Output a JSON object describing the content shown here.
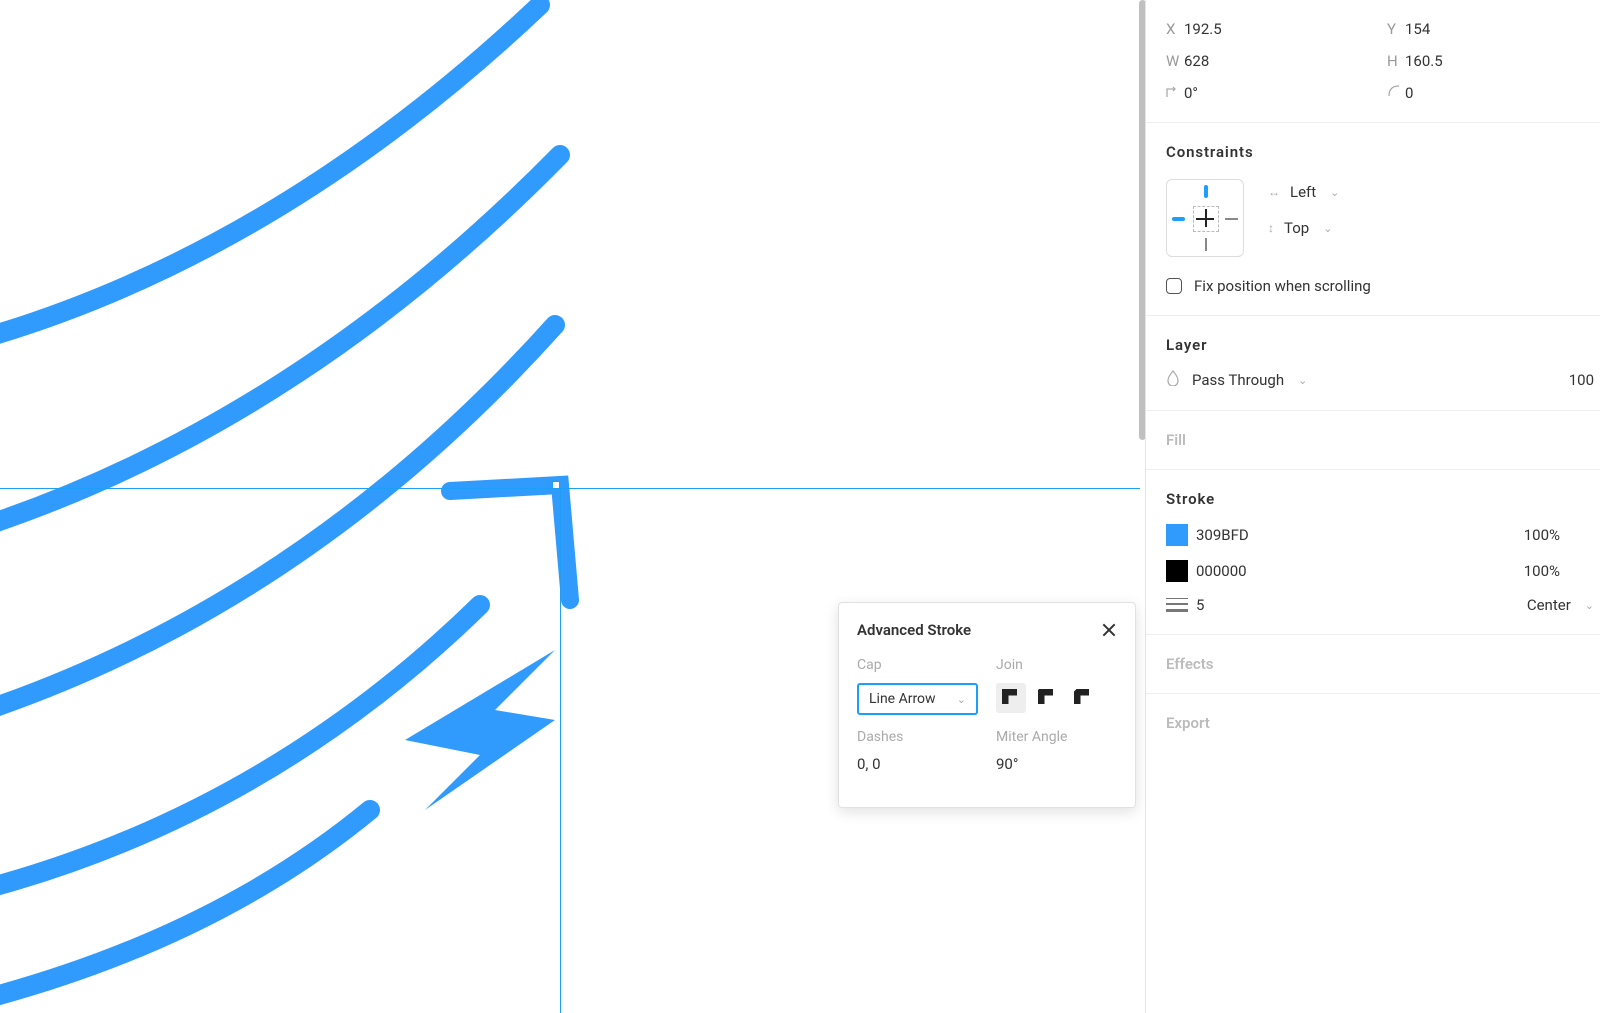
{
  "colors": {
    "accent": "#309BFD"
  },
  "transform": {
    "x_label": "X",
    "x": "192.5",
    "y_label": "Y",
    "y": "154",
    "w_label": "W",
    "w": "628",
    "h_label": "H",
    "h": "160.5",
    "rotation": "0°",
    "radius": "0"
  },
  "constraints": {
    "title": "Constraints",
    "horizontal": "Left",
    "vertical": "Top",
    "fix_label": "Fix position when scrolling"
  },
  "layer": {
    "title": "Layer",
    "blend": "Pass Through",
    "opacity": "100"
  },
  "fill": {
    "title": "Fill"
  },
  "stroke": {
    "title": "Stroke",
    "items": [
      {
        "hex": "309BFD",
        "opacity": "100%",
        "swatch": "#309BFD"
      },
      {
        "hex": "000000",
        "opacity": "100%",
        "swatch": "#000000"
      }
    ],
    "weight": "5",
    "align": "Center"
  },
  "effects": {
    "title": "Effects"
  },
  "export": {
    "title": "Export"
  },
  "advanced_stroke": {
    "title": "Advanced Stroke",
    "cap_label": "Cap",
    "cap_value": "Line Arrow",
    "join_label": "Join",
    "dashes_label": "Dashes",
    "dashes_value": "0, 0",
    "miter_label": "Miter Angle",
    "miter_value": "90°"
  }
}
